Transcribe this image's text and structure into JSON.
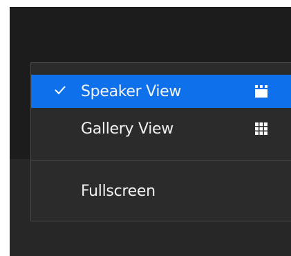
{
  "view_menu": {
    "items": [
      {
        "label": "Speaker View",
        "selected": true,
        "icon": "speaker-view-icon"
      },
      {
        "label": "Gallery View",
        "selected": false,
        "icon": "gallery-view-icon"
      }
    ],
    "fullscreen_label": "Fullscreen",
    "check_icon": "check-icon"
  },
  "colors": {
    "selected_bg": "#0e71eb",
    "menu_bg": "#2b2b2b",
    "text": "#f2f2f2"
  }
}
